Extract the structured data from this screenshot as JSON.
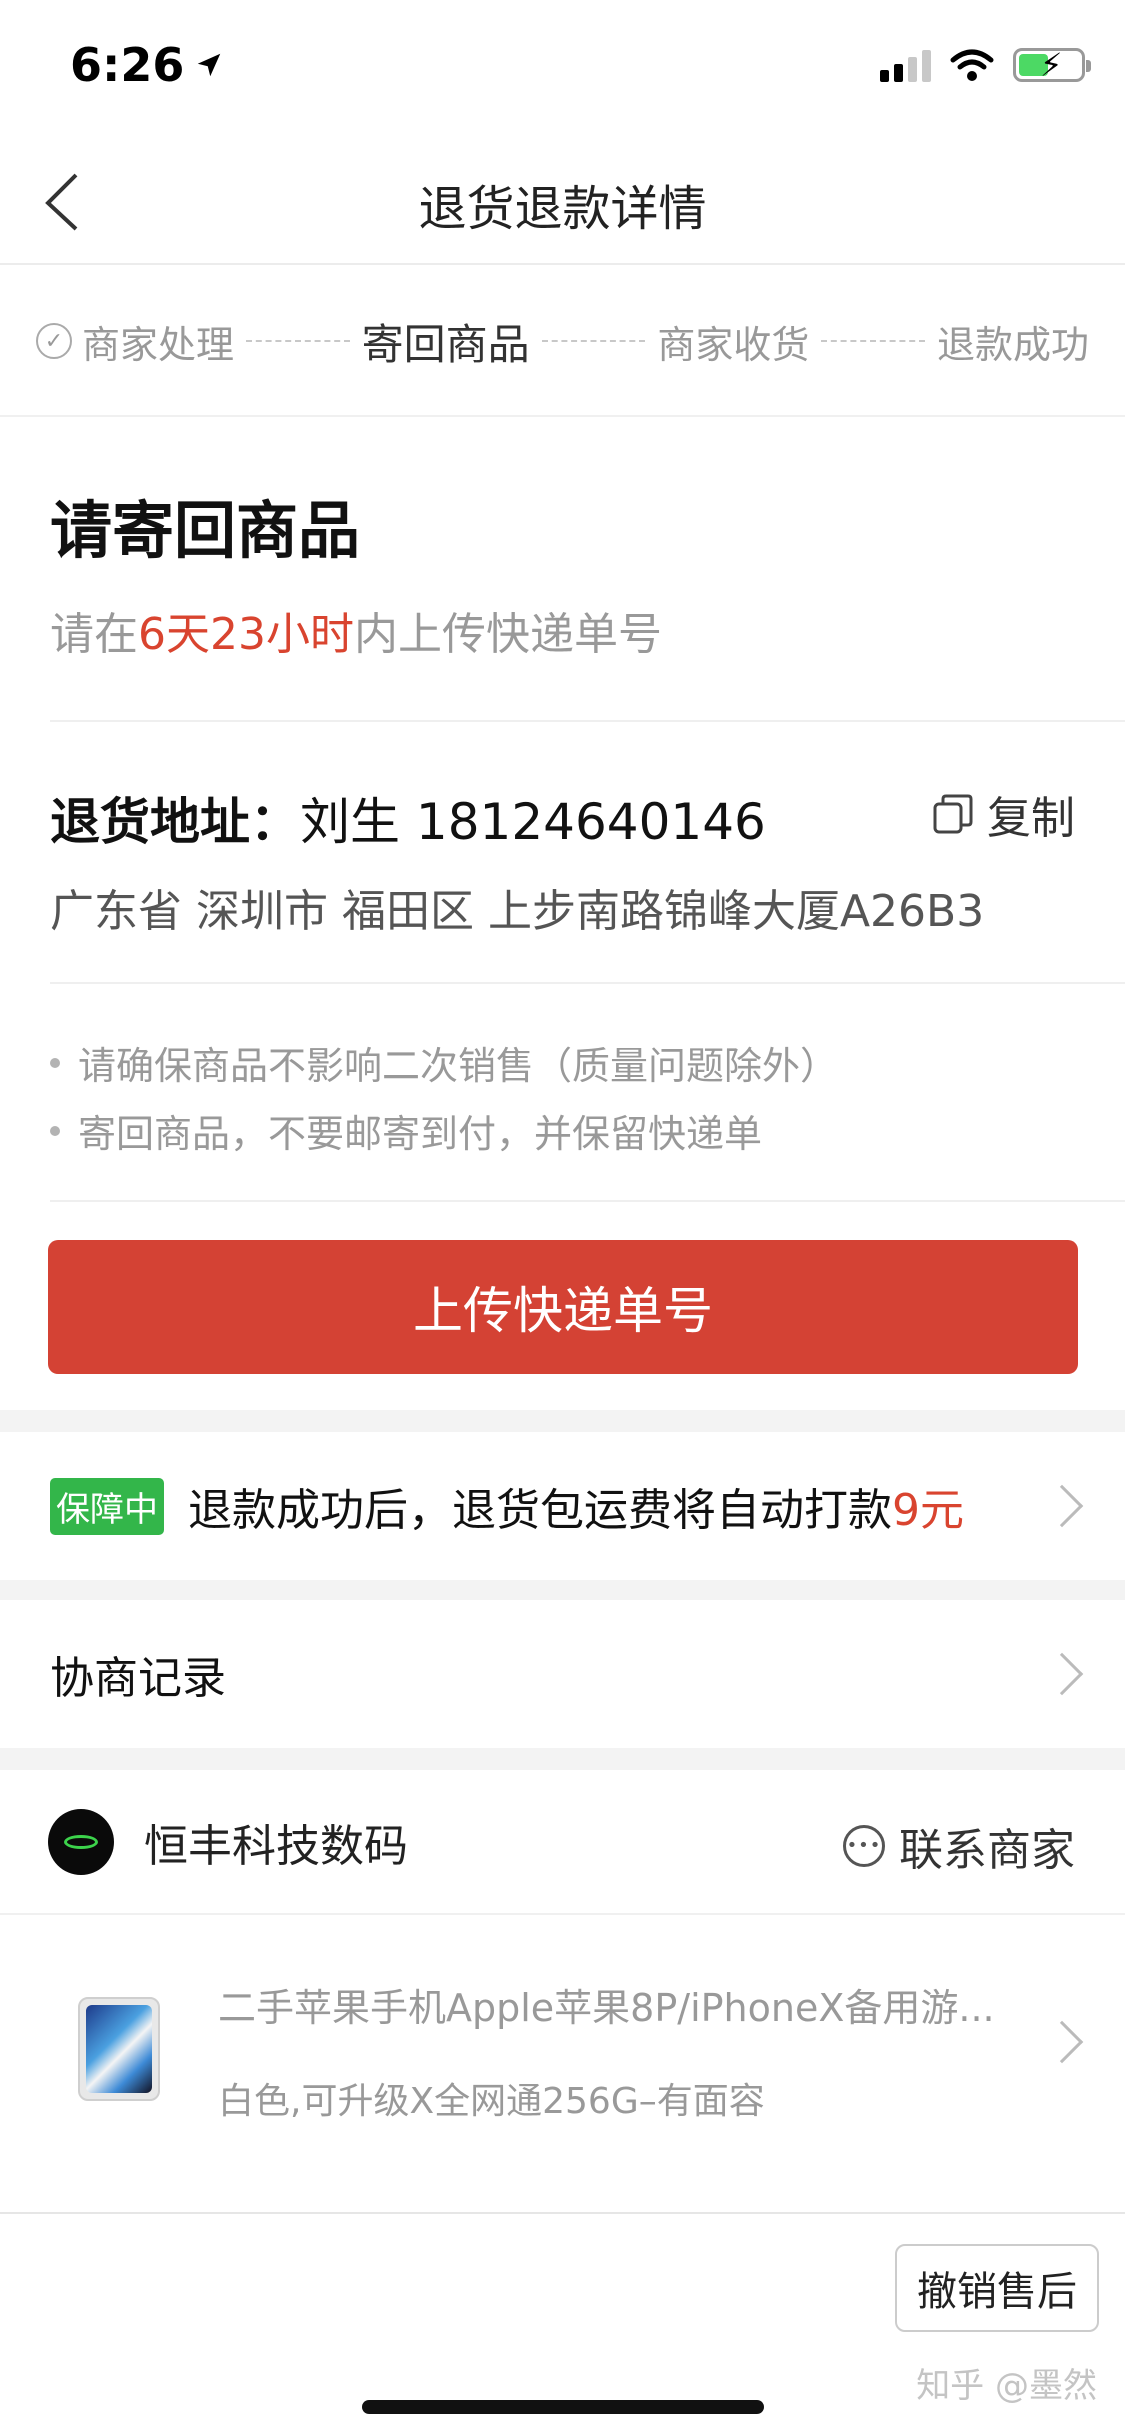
{
  "status_bar": {
    "time": "6:26"
  },
  "nav": {
    "title": "退货退款详情"
  },
  "progress": {
    "steps": [
      "商家处理",
      "寄回商品",
      "商家收货",
      "退款成功"
    ],
    "current_index": 1
  },
  "status": {
    "title": "请寄回商品",
    "deadline_prefix": "请在",
    "deadline_time": "6天23小时",
    "deadline_suffix": "内上传快递单号"
  },
  "address": {
    "label": "退货地址：",
    "contact": "刘生 18124640146",
    "copy_label": "复制",
    "detail": "广东省 深圳市 福田区 上步南路锦峰大厦A26B3"
  },
  "notes": [
    "请确保商品不影响二次销售（质量问题除外）",
    "寄回商品，不要邮寄到付，并保留快递单"
  ],
  "upload_button": "上传快递单号",
  "guarantee": {
    "badge": "保障中",
    "text": "退款成功后，退货包运费将自动打款",
    "amount": "9元"
  },
  "negotiation": {
    "label": "协商记录"
  },
  "shop": {
    "name": "恒丰科技数码",
    "contact_label": "联系商家"
  },
  "product": {
    "title": "二手苹果手机Apple苹果8P/iPhoneX备用游...",
    "spec": "白色,可升级X全网通256G–有面容"
  },
  "bottom": {
    "cancel_button": "撤销售后",
    "watermark": "知乎 @墨然"
  },
  "colors": {
    "accent_red": "#d44234",
    "badge_green": "#33b64a"
  }
}
